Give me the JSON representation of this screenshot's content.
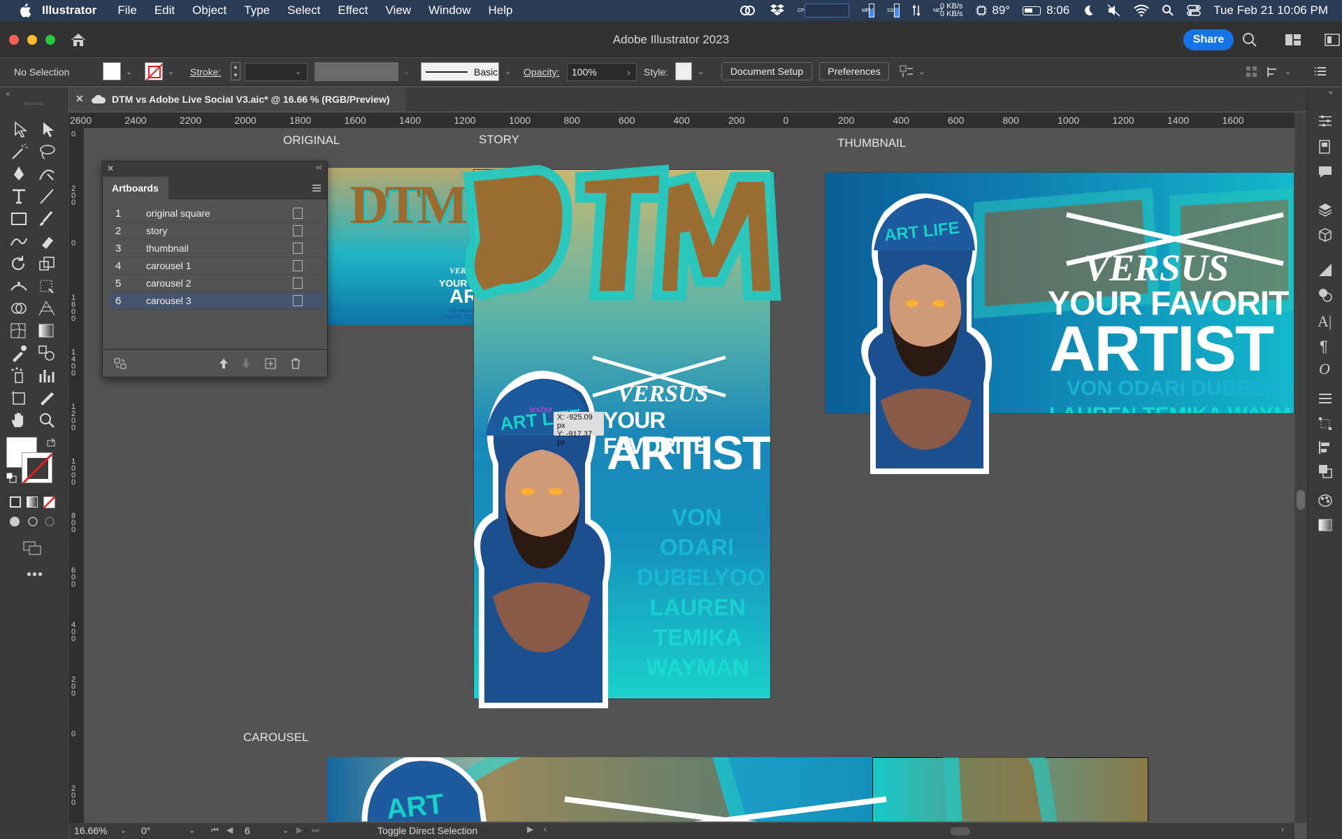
{
  "menubar": {
    "items": [
      "Illustrator",
      "File",
      "Edit",
      "Object",
      "Type",
      "Select",
      "Effect",
      "View",
      "Window",
      "Help"
    ],
    "net_up": "0 KB/s",
    "net_down": "0 KB/s",
    "temperature": "89°",
    "battery_time": "8:06",
    "datetime": "Tue Feb 21  10:06 PM",
    "meter_labels": [
      "CPU",
      "MEM",
      "SSD",
      "NET"
    ]
  },
  "titlebar": {
    "title": "Adobe Illustrator 2023",
    "share": "Share"
  },
  "controlbar": {
    "selection": "No Selection",
    "stroke_label": "Stroke:",
    "brush": "Basic",
    "opacity_label": "Opacity:",
    "opacity_value": "100%",
    "style_label": "Style:",
    "doc_setup": "Document Setup",
    "preferences": "Preferences"
  },
  "document": {
    "tab_title": "DTM vs Adobe Live Social V3.aic* @ 16.66 % (RGB/Preview)"
  },
  "ruler": [
    "2600",
    "2400",
    "2200",
    "2000",
    "1800",
    "1600",
    "1400",
    "1200",
    "1000",
    "800",
    "600",
    "400",
    "200",
    "0",
    "200",
    "400",
    "600",
    "800",
    "1000",
    "1200",
    "1400",
    "1600"
  ],
  "vruler": [
    "0",
    "200",
    "0",
    "1600",
    "1400",
    "1200",
    "1000",
    "800",
    "600",
    "400",
    "200",
    "0",
    "200"
  ],
  "artboard_labels": {
    "original": "ORIGINAL",
    "story": "STORY",
    "thumbnail": "THUMBNAIL",
    "carousel": "CAROUSEL"
  },
  "artwork": {
    "versus": "VERSUS",
    "favorite": "YOUR FAVORITE",
    "favorite_cut": "YOUR FAVORIT",
    "artist": "ARTIST",
    "artist_cut": "ARTIST",
    "names_line1": "VON ODARI DUBELYOO",
    "names_line2": "LAUREN TEMIKA WAYMAN",
    "names_line1_cut": "VON ODARI DUBELYOO",
    "names_line2_cut": "LAUREN TEMIKA WAYMA",
    "story_names": [
      "VON",
      "ODARI",
      "DUBELYOO",
      "LAUREN",
      "TEMIKA",
      "WAYMAN"
    ],
    "cap_text": "ART LIFE",
    "logo": "DTM"
  },
  "cursor": {
    "anchor": "anchor",
    "x_readout": "X: -925.09 px",
    "y_readout": "Y: -917.37 px"
  },
  "artboards_panel": {
    "title": "Artboards",
    "rows": [
      {
        "num": "1",
        "name": "original square"
      },
      {
        "num": "2",
        "name": "story"
      },
      {
        "num": "3",
        "name": "thumbnail"
      },
      {
        "num": "4",
        "name": "carousel 1"
      },
      {
        "num": "5",
        "name": "carousel 2"
      },
      {
        "num": "6",
        "name": "carousel 3"
      }
    ],
    "selected": 6
  },
  "statusbar": {
    "zoom": "16.66%",
    "rotation": "0°",
    "artboard_num": "6",
    "tool_hint": "Toggle Direct Selection"
  },
  "colors": {
    "accent": "#1473e6",
    "menubar": "#2a3b55",
    "canvas": "#535353",
    "artwork_teal": "#19d6d0",
    "artwork_brown": "#9a6a2e"
  }
}
